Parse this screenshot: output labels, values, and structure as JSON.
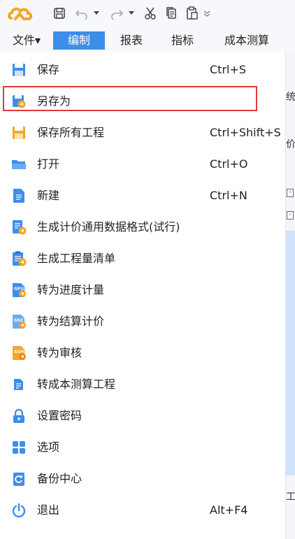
{
  "menubar": {
    "tabs": [
      {
        "label": "文件▾"
      },
      {
        "label": "编制"
      },
      {
        "label": "报表"
      },
      {
        "label": "指标"
      },
      {
        "label": "成本测算"
      }
    ]
  },
  "menu": {
    "items": [
      {
        "label": "保存",
        "shortcut": "Ctrl+S",
        "icon": "save-icon"
      },
      {
        "label": "另存为",
        "shortcut": "",
        "icon": "save-as-icon"
      },
      {
        "label": "保存所有工程",
        "shortcut": "Ctrl+Shift+S",
        "icon": "save-all-icon"
      },
      {
        "label": "打开",
        "shortcut": "Ctrl+O",
        "icon": "folder-open-icon"
      },
      {
        "label": "新建",
        "shortcut": "Ctrl+N",
        "icon": "new-document-icon"
      },
      {
        "label": "生成计价通用数据格式(试行)",
        "shortcut": "",
        "icon": "export-format-icon"
      },
      {
        "label": "生成工程量清单",
        "shortcut": "",
        "icon": "bill-of-quantities-icon"
      },
      {
        "label": "转为进度计量",
        "shortcut": "",
        "icon": "gpu-convert-icon"
      },
      {
        "label": "转为结算计价",
        "shortcut": "",
        "icon": "gsc-convert-icon"
      },
      {
        "label": "转为审核",
        "shortcut": "",
        "icon": "gsh-convert-icon"
      },
      {
        "label": "转成本测算工程",
        "shortcut": "",
        "icon": "cost-estimate-icon"
      },
      {
        "label": "设置密码",
        "shortcut": "",
        "icon": "lock-icon"
      },
      {
        "label": "选项",
        "shortcut": "",
        "icon": "grid-options-icon"
      },
      {
        "label": "备份中心",
        "shortcut": "",
        "icon": "backup-icon"
      },
      {
        "label": "退出",
        "shortcut": "Alt+F4",
        "icon": "power-icon"
      }
    ]
  },
  "background": {
    "fragments": [
      "统",
      "价",
      "工程"
    ]
  },
  "colors": {
    "accent": "#3d8ee8",
    "highlight_border": "#e03a3a",
    "logo": "#f5a623"
  }
}
